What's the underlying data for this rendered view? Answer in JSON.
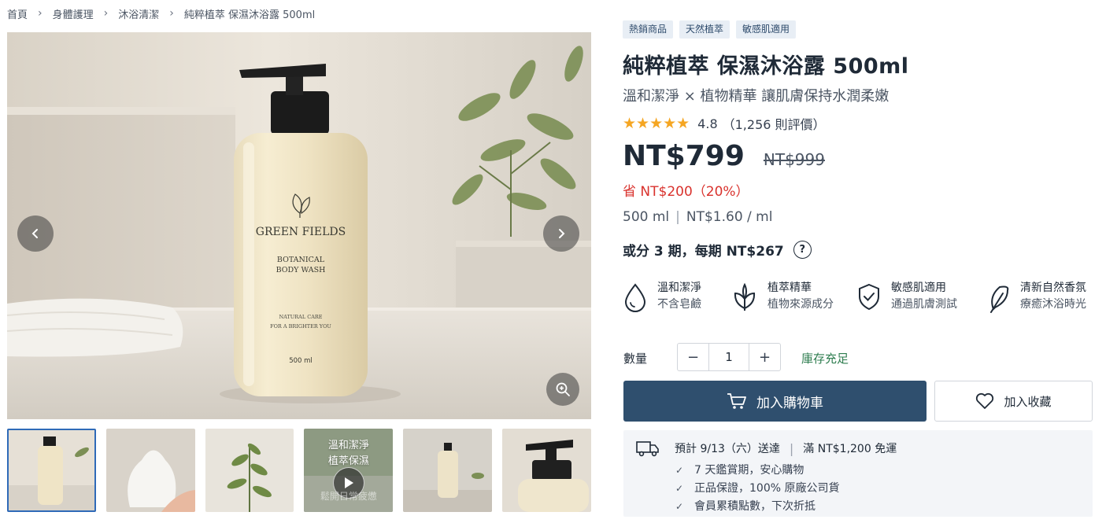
{
  "breadcrumb": [
    "首頁",
    "身體護理",
    "沐浴清潔",
    "純粹植萃 保濕沐浴露 500ml"
  ],
  "product_image": {
    "bottle_brand": "GREEN FIELDS",
    "bottle_line1": "BOTANICAL",
    "bottle_line2": "BODY WASH",
    "bottle_tag1": "NATURAL CARE",
    "bottle_tag2": "FOR A BRIGHTER YOU",
    "bottle_volume": "500 ml"
  },
  "thumbnails": {
    "video_title1": "溫和潔淨",
    "video_title2": "植萃保濕",
    "video_caption": "鬆開日常疲憊"
  },
  "tags": [
    "熱銷商品",
    "天然植萃",
    "敏感肌適用"
  ],
  "title": "純粹植萃 保濕沐浴露 500ml",
  "subtitle": "溫和潔淨 × 植物精華 讓肌膚保持水潤柔嫩",
  "rating": {
    "stars": "★★★★★",
    "score": "4.8",
    "count": "（1,256 則評價）"
  },
  "price": {
    "current": "NT$799",
    "original": "NT$999",
    "save": "省 NT$200（20%）",
    "unit_size": "500 ml",
    "unit_price": "NT$1.60 / ml",
    "installment": "或分 3 期，每期 NT$267"
  },
  "features": [
    {
      "title": "溫和潔淨",
      "desc": "不含皂鹼",
      "icon": "drop-icon"
    },
    {
      "title": "植萃精華",
      "desc": "植物來源成分",
      "icon": "leaf-icon"
    },
    {
      "title": "敏感肌適用",
      "desc": "通過肌膚測試",
      "icon": "shield-icon"
    },
    {
      "title": "清新自然香氛",
      "desc": "療癒沐浴時光",
      "icon": "feather-leaf-icon"
    }
  ],
  "quantity": {
    "label": "數量",
    "minus": "−",
    "value": "1",
    "plus": "+",
    "stock": "庫存充足"
  },
  "actions": {
    "add_to_cart": "加入購物車",
    "wishlist": "加入收藏"
  },
  "shipping": {
    "estimate": "預計 9/13（六）送達",
    "free_shipping": "滿 NT$1,200 免運",
    "items": [
      "7 天鑑賞期，安心購物",
      "正品保證，100% 原廠公司貨",
      "會員累積點數，下次折抵"
    ]
  },
  "colors": {
    "primary": "#2f4f6e",
    "discount": "#d9322d",
    "stock": "#2e7d4f",
    "star": "#f5a623",
    "tag_bg": "#e8eef5"
  }
}
